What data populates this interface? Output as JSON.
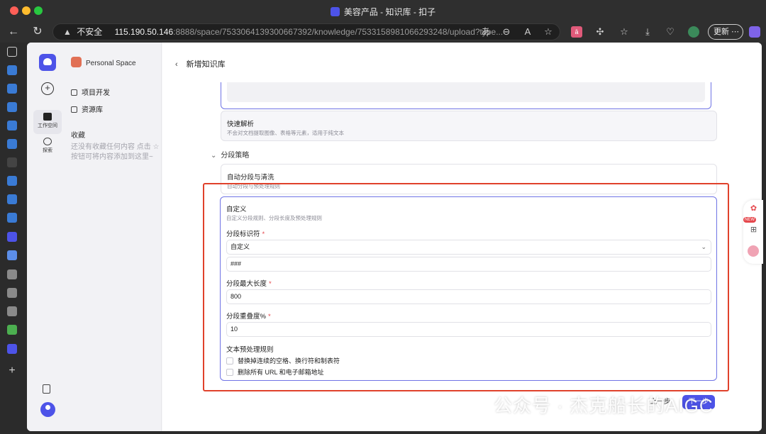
{
  "window": {
    "title": "美容产品 - 知识库 - 扣子"
  },
  "address_bar": {
    "insecure_label": "不安全",
    "host": "115.190.50.146",
    "path": ":8888/space/7533064139300667392/knowledge/7533158981066293248/upload?type...",
    "update_label": "更新"
  },
  "app_rail": {
    "workspace_label": "工作空间",
    "explore_label": "探索"
  },
  "panel": {
    "space_name": "Personal Space",
    "items": [
      {
        "label": "项目开发"
      },
      {
        "label": "资源库"
      }
    ],
    "favorites_title": "收藏",
    "favorites_empty": "还没有收藏任何内容 点击 ☆ 按钮可将内容添加到这里~"
  },
  "header": {
    "title": "新增知识库"
  },
  "parse_options": {
    "fast_title": "快速解析",
    "fast_desc": "不会对文档提取图像、表格等元素，适用于纯文本"
  },
  "segment": {
    "section_title": "分段策略",
    "auto_title": "自动分段与清洗",
    "auto_desc": "自动分段与预处理规则",
    "custom_title": "自定义",
    "custom_desc": "自定义分段规则、分段长度及预处理规则",
    "identifier_label": "分段标识符",
    "identifier_select": "自定义",
    "identifier_value": "###",
    "max_length_label": "分段最大长度",
    "max_length_value": "800",
    "overlap_label": "分段重叠度%",
    "overlap_value": "10",
    "preprocess_title": "文本预处理规则",
    "rules": [
      {
        "label": "替换掉连续的空格、换行符和制表符"
      },
      {
        "label": "删除所有 URL 和电子邮箱地址"
      }
    ]
  },
  "footer": {
    "prev_label": "上一步",
    "next_label": "下一步"
  },
  "float_tools": {
    "new_badge": "NEW"
  },
  "watermark": {
    "text": "公众号 · 杰克船长的AIGC"
  },
  "colors": {
    "accent": "#4d53e8",
    "highlight_frame": "#e0412b",
    "required": "#e5484d"
  }
}
